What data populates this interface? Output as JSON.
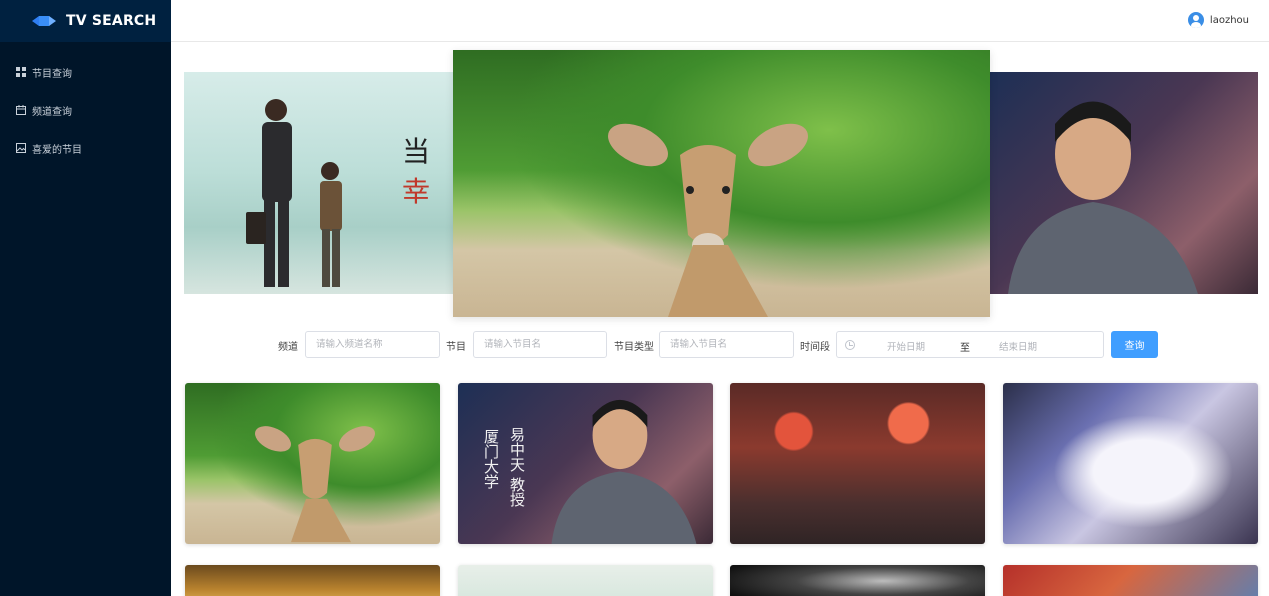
{
  "app": {
    "title": "TV SEARCH"
  },
  "sidebar": {
    "items": [
      {
        "label": "节目查询",
        "icon": "grid-icon"
      },
      {
        "label": "频道查询",
        "icon": "calendar-icon"
      },
      {
        "label": "喜爱的节目",
        "icon": "image-icon"
      }
    ]
  },
  "header": {
    "username": "laozhou",
    "avatar_icon": "user-avatar-icon"
  },
  "carousel": {
    "slides": [
      {
        "name": "slide-movie-poster",
        "text_black": "当",
        "text_red": "幸"
      },
      {
        "name": "slide-deer"
      },
      {
        "name": "slide-anchor"
      }
    ]
  },
  "search": {
    "channel_label": "频道",
    "channel_placeholder": "请输入频道名称",
    "program_label": "节目",
    "program_placeholder": "请输入节目名",
    "type_label": "节目类型",
    "type_placeholder": "请输入节目名",
    "period_label": "时间段",
    "start_placeholder": "开始日期",
    "range_separator": "至",
    "end_placeholder": "结束日期",
    "query_button": "查询"
  },
  "cards": [
    {
      "name": "deer"
    },
    {
      "name": "lecture",
      "vertical_text_1": "易中天 教授",
      "vertical_text_2": "厦门大学"
    },
    {
      "name": "anime-street"
    },
    {
      "name": "anime-mecha"
    },
    {
      "name": "sunset-portrait"
    },
    {
      "name": "misty-figure"
    },
    {
      "name": "dark-scene"
    },
    {
      "name": "fire-scene"
    }
  ],
  "colors": {
    "sidebar_bg": "#001529",
    "logo_bg": "#002140",
    "primary": "#409eff"
  }
}
